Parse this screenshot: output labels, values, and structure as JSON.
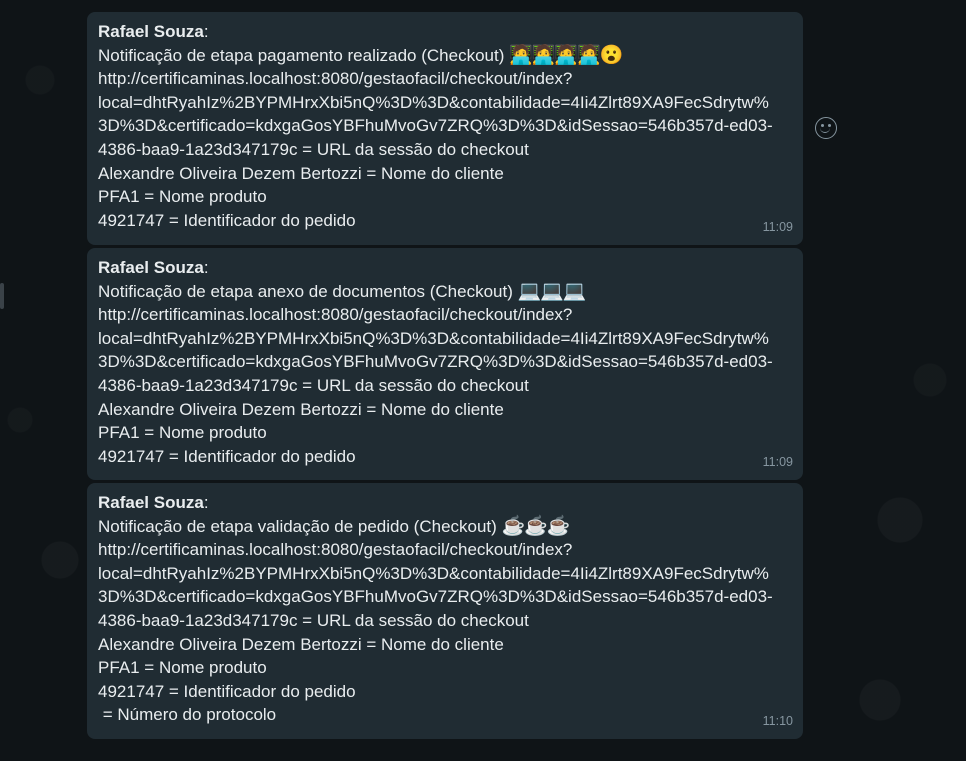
{
  "messages": [
    {
      "sender": "Rafael Souza",
      "sender_suffix": ":",
      "title": "Notificação de etapa pagamento realizado (Checkout) ",
      "emojis": "🧑‍💻🧑‍💻🧑‍💻🧑‍💻😮",
      "url_lines": [
        "http://certificaminas.localhost:8080/gestaofacil/checkout/index?",
        "local=dhtRyahIz%2BYPMHrxXbi5nQ%3D%3D&contabilidade=4Ii4Zlrt89XA9FecSdrytw%",
        "3D%3D&certificado=kdxgaGosYBFhuMvoGv7ZRQ%3D%3D&idSessao=546b357d-ed03-",
        "4386-baa9-1a23d347179c = URL da sessão do checkout"
      ],
      "details": [
        "Alexandre Oliveira Dezem Bertozzi = Nome do cliente",
        "PFA1 = Nome produto",
        "4921747 = Identificador do pedido"
      ],
      "time": "11:09"
    },
    {
      "sender": "Rafael Souza",
      "sender_suffix": ":",
      "title": "Notificação de etapa anexo de documentos (Checkout) ",
      "emojis": "💻💻💻",
      "url_lines": [
        "http://certificaminas.localhost:8080/gestaofacil/checkout/index?",
        "local=dhtRyahIz%2BYPMHrxXbi5nQ%3D%3D&contabilidade=4Ii4Zlrt89XA9FecSdrytw%",
        "3D%3D&certificado=kdxgaGosYBFhuMvoGv7ZRQ%3D%3D&idSessao=546b357d-ed03-",
        "4386-baa9-1a23d347179c = URL da sessão do checkout"
      ],
      "details": [
        "Alexandre Oliveira Dezem Bertozzi = Nome do cliente",
        "PFA1 = Nome produto",
        "4921747 = Identificador do pedido"
      ],
      "time": "11:09"
    },
    {
      "sender": "Rafael Souza",
      "sender_suffix": ":",
      "title": "Notificação de etapa validação de pedido (Checkout) ",
      "emojis": "☕☕☕",
      "url_lines": [
        "http://certificaminas.localhost:8080/gestaofacil/checkout/index?",
        "local=dhtRyahIz%2BYPMHrxXbi5nQ%3D%3D&contabilidade=4Ii4Zlrt89XA9FecSdrytw%",
        "3D%3D&certificado=kdxgaGosYBFhuMvoGv7ZRQ%3D%3D&idSessao=546b357d-ed03-",
        "4386-baa9-1a23d347179c = URL da sessão do checkout"
      ],
      "details": [
        "Alexandre Oliveira Dezem Bertozzi = Nome do cliente",
        "PFA1 = Nome produto",
        "4921747 = Identificador do pedido",
        " = Número do protocolo"
      ],
      "time": "11:10"
    }
  ],
  "reaction_icon": "smiley-icon",
  "colors": {
    "bubble": "#202c33",
    "text": "#e9edef",
    "meta": "#8696a0"
  }
}
